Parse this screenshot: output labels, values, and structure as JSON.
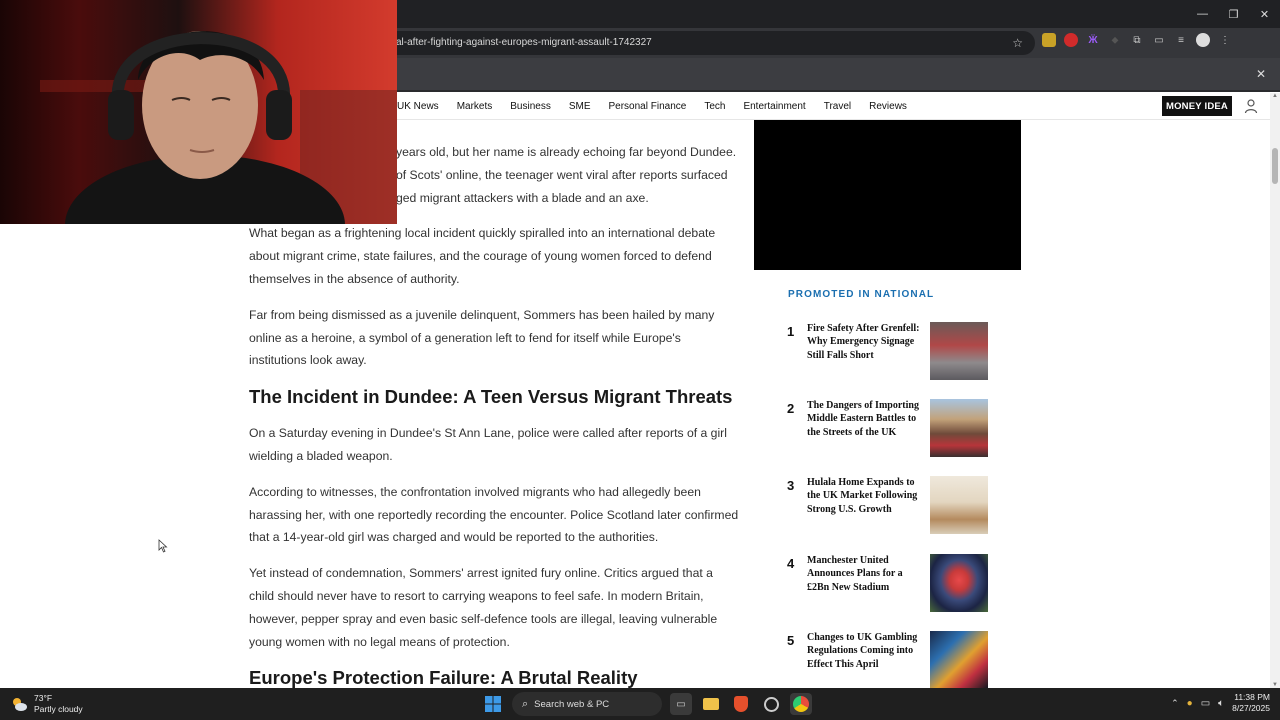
{
  "browser": {
    "url": "al-after-fighting-against-europes-migrant-assault-1742327",
    "window_controls": [
      "—",
      "❐",
      "✕"
    ]
  },
  "nav": {
    "items": [
      "UK News",
      "Markets",
      "Business",
      "SME",
      "Personal Finance",
      "Tech",
      "Entertainment",
      "Travel",
      "Reviews"
    ],
    "money_idea": "MONEY IDEA"
  },
  "article": {
    "p1": "years old, but her name is already echoing far beyond Dundee. of Scots' online, the teenager went viral after reports surfaced ged migrant attackers with a blade and an axe.",
    "p2": "What began as a frightening local incident quickly spiralled into an international debate about migrant crime, state failures, and the courage of young women forced to defend themselves in the absence of authority.",
    "p3": "Far from being dismissed as a juvenile delinquent, Sommers has been hailed by many online as a heroine, a symbol of a generation left to fend for itself while Europe's institutions look away.",
    "h2a": "The Incident in Dundee: A Teen Versus Migrant Threats",
    "p4": "On a Saturday evening in Dundee's St Ann Lane, police were called after reports of a girl wielding a bladed weapon.",
    "p5": "According to witnesses, the confrontation involved migrants who had allegedly been harassing her, with one reportedly recording the encounter. Police Scotland later confirmed that a 14-year-old girl was charged and would be reported to the authorities.",
    "p6": "Yet instead of condemnation, Sommers' arrest ignited fury online. Critics argued that a child should never have to resort to carrying weapons to feel safe. In modern Britain, however, pepper spray and even basic self-defence tools are illegal, leaving vulnerable young women with no legal means of protection.",
    "h2b": "Europe's Protection Failure: A Brutal Reality"
  },
  "sidebar": {
    "promo_title": "PROMOTED IN NATIONAL",
    "items": [
      {
        "num": "1",
        "title": "Fire Safety After Grenfell: Why Emergency Signage Still Falls Short"
      },
      {
        "num": "2",
        "title": "The Dangers of Importing Middle Eastern Battles to the Streets of the UK"
      },
      {
        "num": "3",
        "title": "Hulala Home Expands to the UK Market Following Strong U.S. Growth"
      },
      {
        "num": "4",
        "title": "Manchester United Announces Plans for a £2Bn New Stadium"
      },
      {
        "num": "5",
        "title": "Changes to UK Gambling Regulations Coming into Effect This April"
      }
    ]
  },
  "taskbar": {
    "temp": "73°F",
    "condition": "Partly cloudy",
    "search": "Search web & PC",
    "time": "11:38 PM",
    "date": "8/27/2025"
  }
}
